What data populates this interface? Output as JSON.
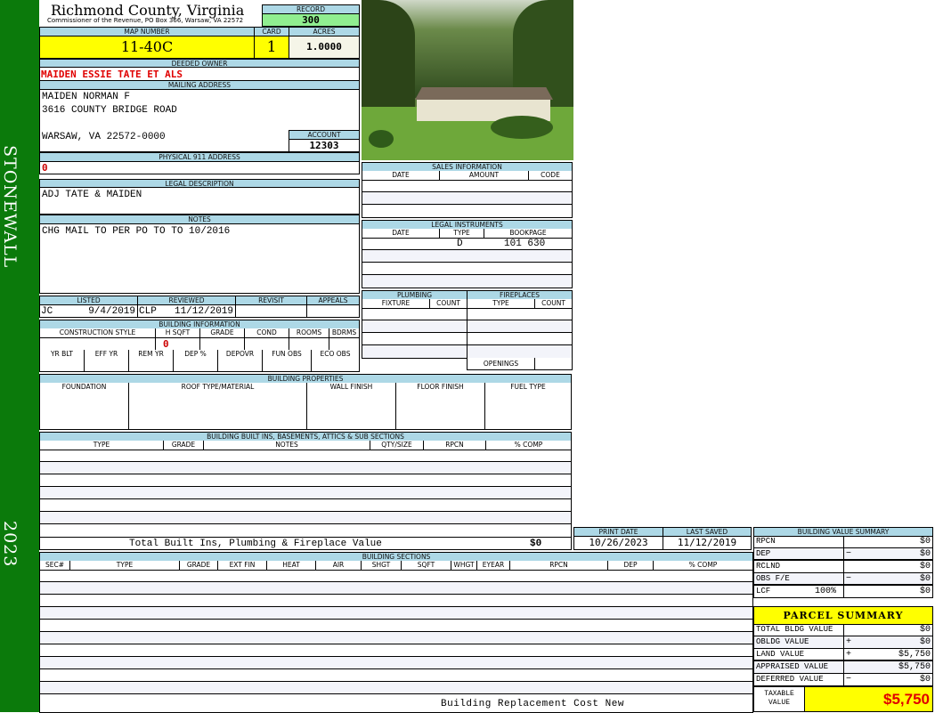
{
  "sidebar": {
    "district": "STONEWALL",
    "year": "2023"
  },
  "header": {
    "title": "Richmond County, Virginia",
    "subtitle": "Commissioner of the Revenue, PO Box 366, Warsaw, VA 22572"
  },
  "record": {
    "label": "RECORD",
    "value": "300"
  },
  "map": {
    "label": "MAP NUMBER",
    "value": "11-40C"
  },
  "card": {
    "label": "CARD",
    "value": "1"
  },
  "acres": {
    "label": "ACRES",
    "value": "1.0000"
  },
  "owner": {
    "label": "DEEDED OWNER",
    "value": "MAIDEN ESSIE TATE ET ALS"
  },
  "mailing": {
    "label": "MAILING ADDRESS",
    "line1": "MAIDEN NORMAN F",
    "line2": "3616 COUNTY BRIDGE ROAD",
    "line3": "WARSAW, VA 22572-0000"
  },
  "account": {
    "label": "ACCOUNT",
    "value": "12303"
  },
  "physical": {
    "label": "PHYSICAL 911 ADDRESS",
    "value": "0"
  },
  "legal": {
    "label": "LEGAL DESCRIPTION",
    "value": "ADJ TATE & MAIDEN"
  },
  "notes": {
    "label": "NOTES",
    "value": "CHG MAIL TO PER PO TO TO 10/2016"
  },
  "review": {
    "headers": [
      "LISTED",
      "REVIEWED",
      "REVISIT",
      "APPEALS"
    ],
    "listed_by": "JC",
    "listed_date": "9/4/2019",
    "reviewed_by": "CLP",
    "reviewed_date": "11/12/2019"
  },
  "building_info": {
    "label": "BUILDING INFORMATION",
    "headers1": [
      "CONSTRUCTION STYLE",
      "H SQFT",
      "GRADE",
      "COND",
      "ROOMS",
      "BDRMS"
    ],
    "hsqft": "0",
    "headers2": [
      "YR BLT",
      "EFF YR",
      "REM YR",
      "DEP %",
      "DEPOVR",
      "FUN OBS",
      "ECO OBS"
    ]
  },
  "sales": {
    "label": "SALES INFORMATION",
    "headers": [
      "DATE",
      "AMOUNT",
      "CODE"
    ]
  },
  "instruments": {
    "label": "LEGAL INSTRUMENTS",
    "headers": [
      "DATE",
      "TYPE",
      "BOOKPAGE"
    ],
    "rows": [
      {
        "date": "",
        "type": "D",
        "bookpage": "101 630"
      }
    ]
  },
  "plumbing": {
    "label": "PLUMBING",
    "headers": [
      "FIXTURE",
      "COUNT"
    ]
  },
  "fireplaces": {
    "label": "FIREPLACES",
    "headers": [
      "TYPE",
      "COUNT"
    ],
    "openings": "OPENINGS"
  },
  "properties": {
    "label": "BUILDING PROPERTIES",
    "headers": [
      "FOUNDATION",
      "ROOF TYPE/MATERIAL",
      "WALL FINISH",
      "FLOOR FINISH",
      "FUEL TYPE"
    ]
  },
  "builtins": {
    "label": "BUILDING BUILT INS, BASEMENTS, ATTICS & SUB SECTIONS",
    "headers": [
      "TYPE",
      "GRADE",
      "NOTES",
      "QTY/SIZE",
      "RPCN",
      "% COMP"
    ],
    "total_label": "Total Built Ins, Plumbing & Fireplace Value",
    "total_value": "$0"
  },
  "dates": {
    "print_label": "PRINT DATE",
    "print_value": "10/26/2023",
    "saved_label": "LAST SAVED",
    "saved_value": "11/12/2019"
  },
  "sections": {
    "label": "BUILDING SECTIONS",
    "headers": [
      "SEC#",
      "TYPE",
      "GRADE",
      "EXT FIN",
      "HEAT",
      "AIR",
      "SHGT",
      "SQFT",
      "WHGT",
      "EYEAR",
      "RPCN",
      "DEP",
      "% COMP"
    ],
    "footer": "Building Replacement Cost New"
  },
  "value_summary": {
    "label": "BUILDING VALUE SUMMARY",
    "rows": [
      {
        "name": "RPCN",
        "op": "",
        "value": "$0"
      },
      {
        "name": "DEP",
        "op": "−",
        "value": "$0"
      },
      {
        "name": "RCLND",
        "op": "",
        "value": "$0"
      },
      {
        "name": "OBS F/E",
        "op": "−",
        "value": "$0"
      },
      {
        "name": "LCF",
        "pct": "100%",
        "op": "",
        "value": "$0"
      }
    ]
  },
  "parcel": {
    "title": "PARCEL SUMMARY",
    "rows": [
      {
        "name": "TOTAL BLDG VALUE",
        "op": "",
        "value": "$0"
      },
      {
        "name": "OBLDG VALUE",
        "op": "+",
        "value": "$0"
      },
      {
        "name": "LAND VALUE",
        "op": "+",
        "value": "$5,750"
      },
      {
        "name": "APPRAISED VALUE",
        "op": "",
        "value": "$5,750"
      },
      {
        "name": "DEFERRED VALUE",
        "op": "−",
        "value": "$0"
      }
    ],
    "taxable_label": "TAXABLE VALUE",
    "taxable_value": "$5,750"
  },
  "colors": {
    "sidebar": "#0b7a0b",
    "label_bg": "#add8e6",
    "highlight": "#ffff00",
    "record_bg": "#90ee90",
    "owner_red": "#e00000"
  }
}
